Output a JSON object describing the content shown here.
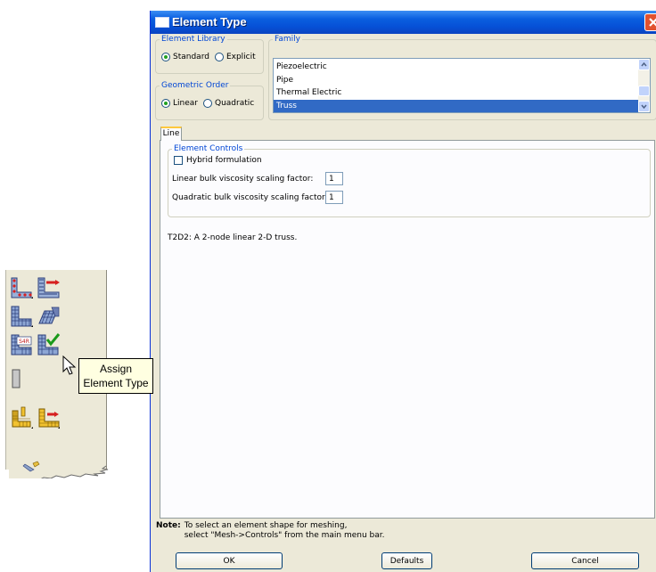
{
  "toolbar": {
    "tooltip": [
      "Assign",
      "Element Type"
    ],
    "icons": [
      "seed-part-icon",
      "seed-edge-icon",
      "mesh-part-icon",
      "mesh-region-icon",
      "assign-element-type-icon",
      "verify-mesh-icon",
      "tool-icon",
      "assign-orientation-icon",
      "assign-stack-icon"
    ],
    "icon_badge": "S4R"
  },
  "dialog": {
    "title": "Element Type",
    "element_library": {
      "legend": "Element Library",
      "options": [
        "Standard",
        "Explicit"
      ],
      "selected": "Standard"
    },
    "geometric_order": {
      "legend": "Geometric Order",
      "options": [
        "Linear",
        "Quadratic"
      ],
      "selected": "Linear"
    },
    "family": {
      "legend": "Family",
      "items": [
        "Piezoelectric",
        "Pipe",
        "Thermal Electric",
        "Truss"
      ],
      "selected": "Truss"
    },
    "tab": "Line",
    "element_controls": {
      "legend": "Element Controls",
      "hybrid_label": "Hybrid formulation",
      "hybrid_checked": false,
      "linear_label": "Linear bulk viscosity scaling factor:",
      "linear_value": "1",
      "quadratic_label": "Quadratic bulk viscosity scaling factor:",
      "quadratic_value": "1"
    },
    "description": "T2D2:  A 2-node linear 2-D truss.",
    "note_label": "Note:",
    "note_lines": [
      "To select an element shape for meshing,",
      "select \"Mesh->Controls\" from the main menu bar."
    ],
    "buttons": {
      "ok": "OK",
      "defaults": "Defaults",
      "cancel": "Cancel"
    },
    "colors": {
      "title_bar": "#0a5fe0",
      "selection": "#316ac5",
      "legend": "#0046d5",
      "tooltip_bg": "#ffffe1"
    }
  }
}
